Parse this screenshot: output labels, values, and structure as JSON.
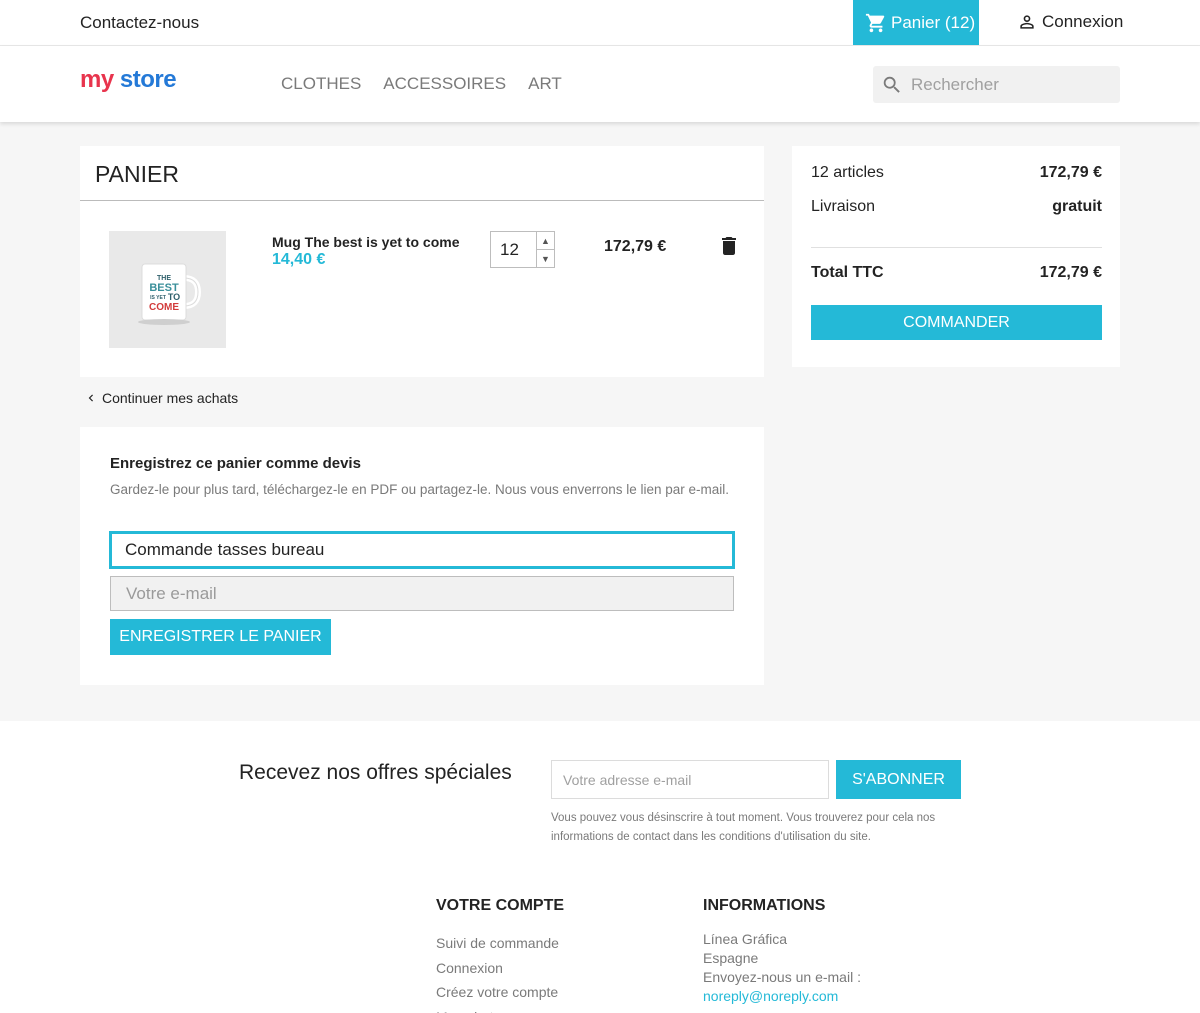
{
  "topbar": {
    "contact": "Contactez-nous",
    "cart_label": "Panier",
    "cart_count": "(12)",
    "login": "Connexion"
  },
  "header": {
    "logo": {
      "w1": "my",
      "w2": "store"
    },
    "nav": [
      "CLOTHES",
      "ACCESSOIRES",
      "ART"
    ],
    "search_placeholder": "Rechercher"
  },
  "cart": {
    "title": "PANIER",
    "item": {
      "name": "Mug The best is yet to come",
      "unit_price": "14,40 €",
      "quantity": "12",
      "line_total": "172,79 €",
      "image_text": [
        "THE",
        "BEST",
        "IS YET",
        "TO",
        "COME"
      ]
    },
    "continue": "Continuer mes achats"
  },
  "quote": {
    "title": "Enregistrez ce panier comme devis",
    "description": "Gardez-le pour plus tard, téléchargez-le en PDF ou partagez-le. Nous vous enverrons le lien par e-mail.",
    "name_value": "Commande tasses bureau",
    "email_placeholder": "Votre e-mail",
    "save_button": "ENREGISTRER LE PANIER"
  },
  "summary": {
    "items_label": "12 articles",
    "items_value": "172,79 €",
    "shipping_label": "Livraison",
    "shipping_value": "gratuit",
    "total_label": "Total TTC",
    "total_value": "172,79 €",
    "order_button": "COMMANDER"
  },
  "newsletter": {
    "title": "Recevez nos offres spéciales",
    "placeholder": "Votre adresse e-mail",
    "button": "S'ABONNER",
    "note": "Vous pouvez vous désinscrire à tout moment. Vous trouverez pour cela nos informations de contact dans les conditions d'utilisation du site."
  },
  "footer": {
    "account_title": "VOTRE COMPTE",
    "account_links": [
      "Suivi de commande",
      "Connexion",
      "Créez votre compte",
      "Mes alertes"
    ],
    "info_title": "INFORMATIONS",
    "info_lines": [
      "Línea Gráfica",
      "Espagne",
      "Envoyez-nous un e-mail :"
    ],
    "info_email": "noreply@noreply.com"
  },
  "colors": {
    "accent": "#24b9d7",
    "text": "#232323",
    "muted": "#7a7a7a",
    "background": "#f6f6f6"
  }
}
